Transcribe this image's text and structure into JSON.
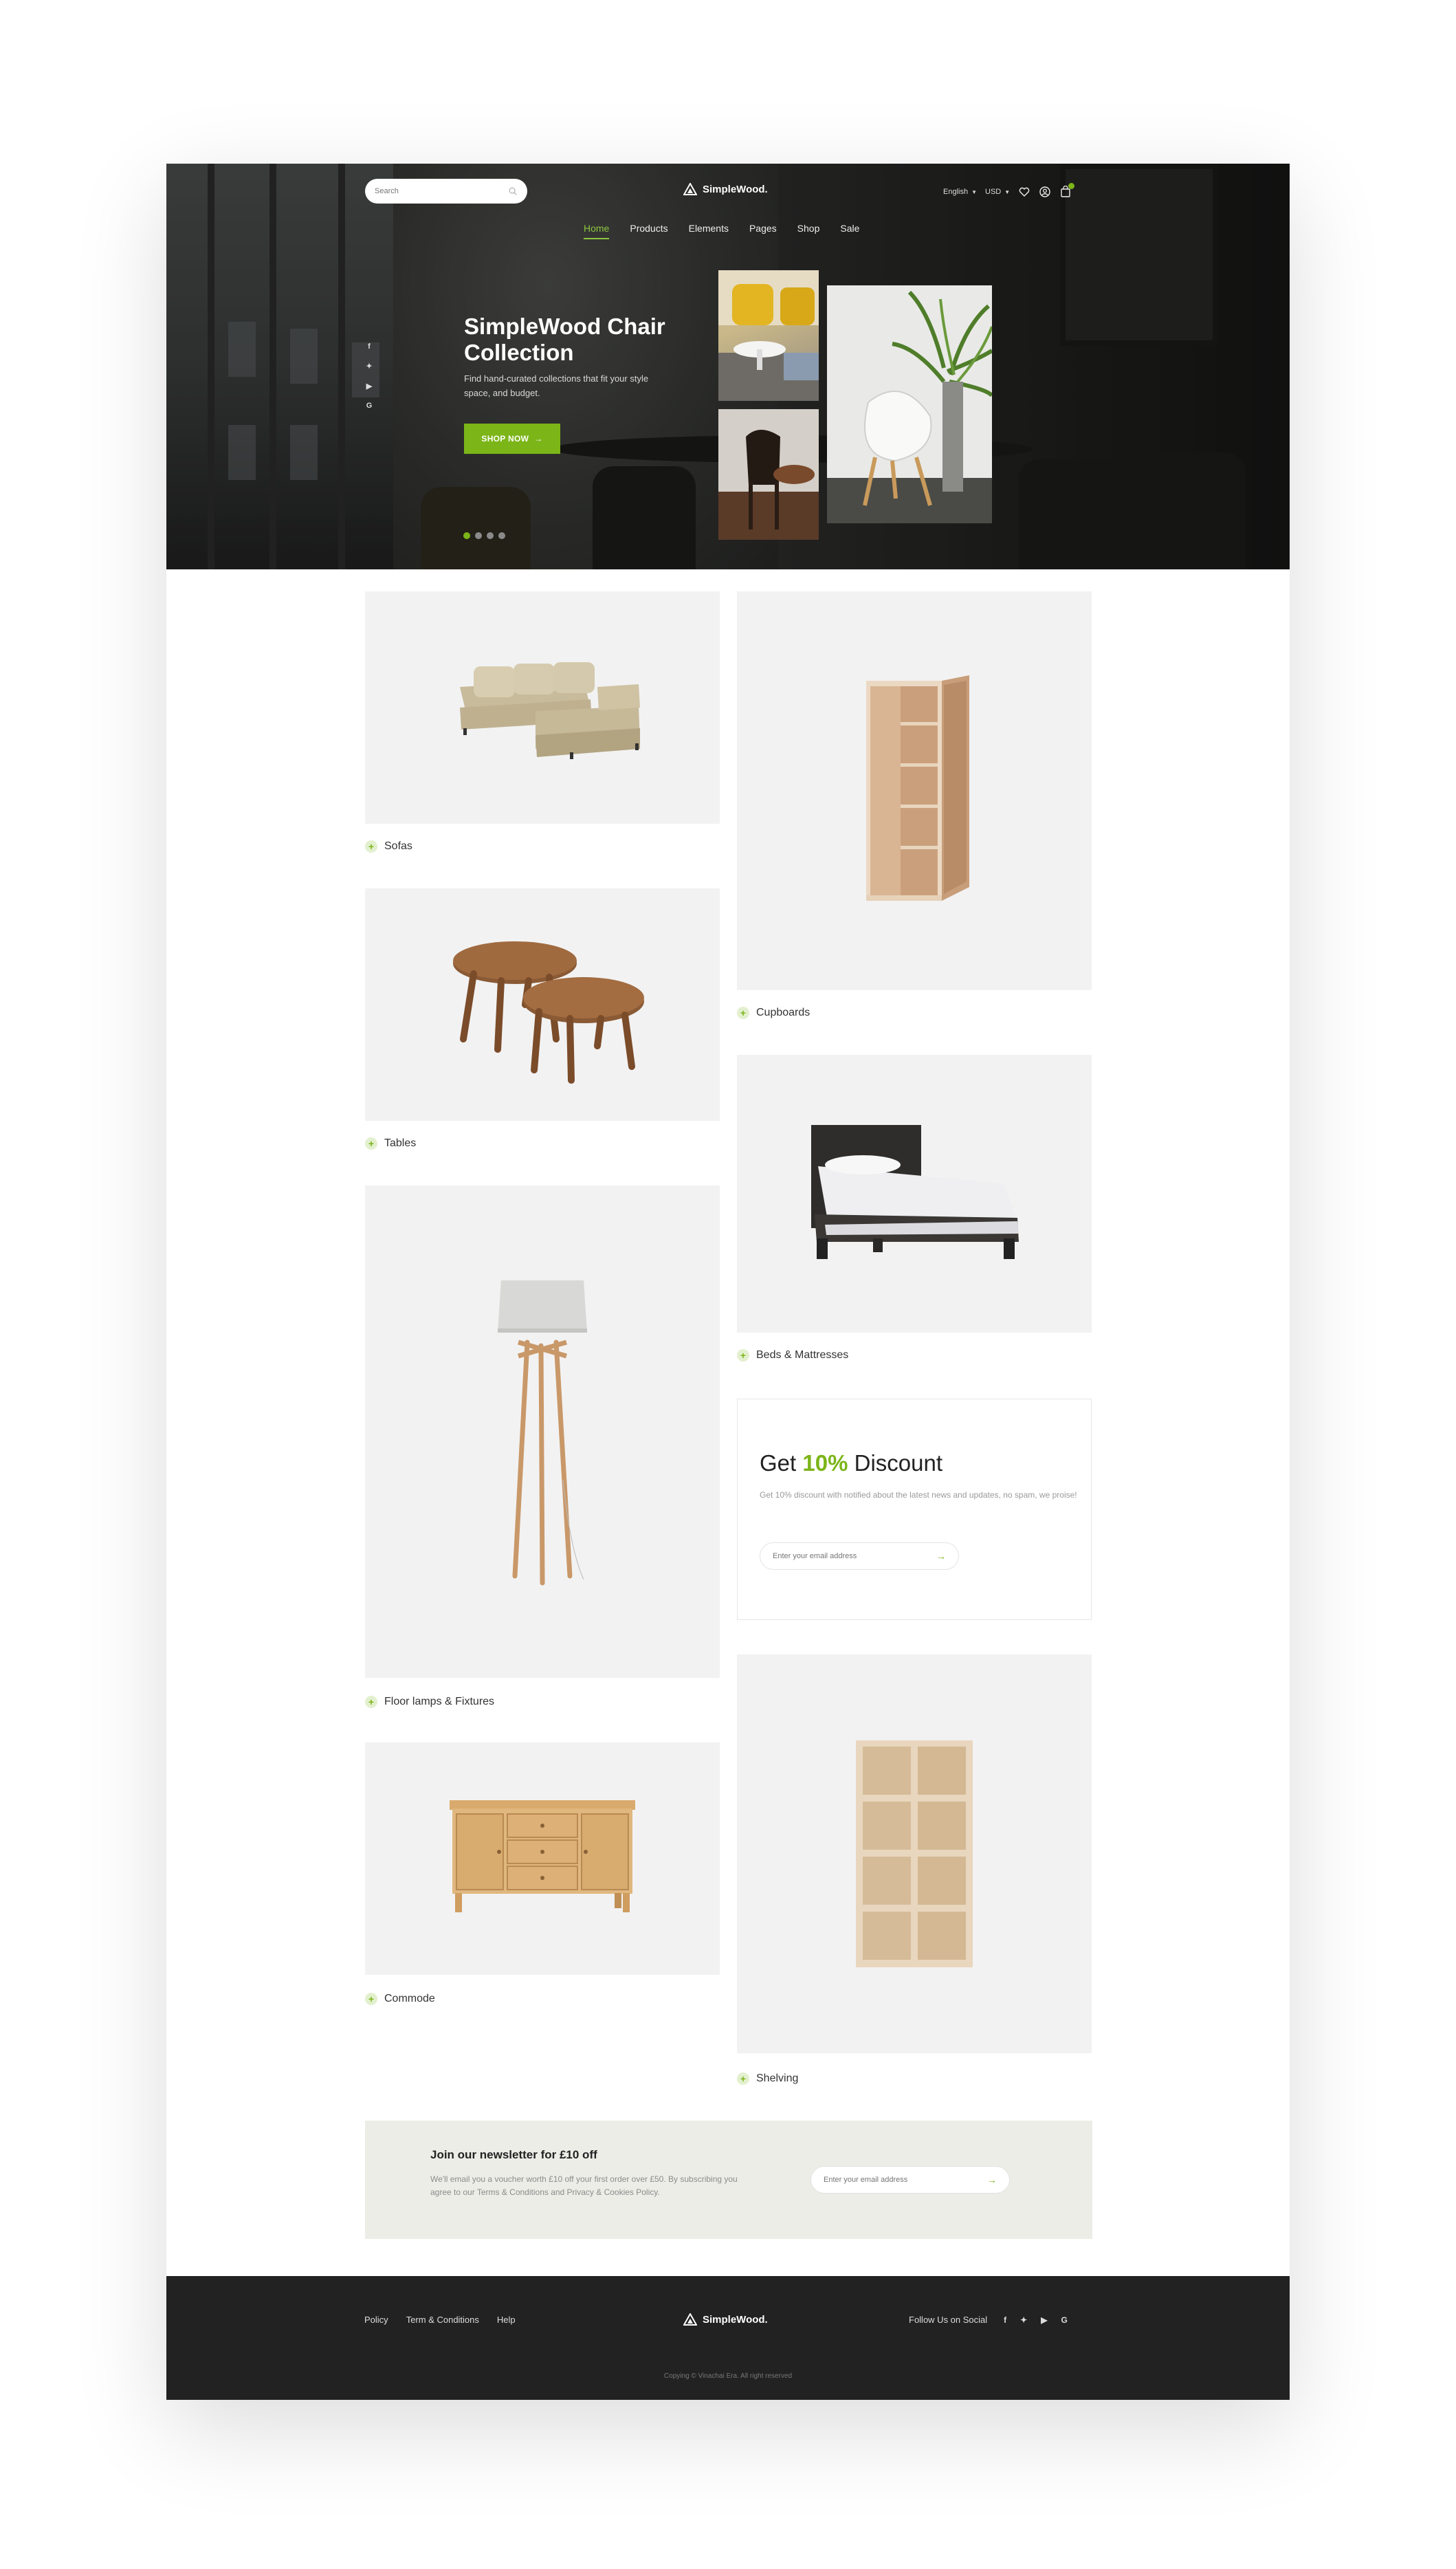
{
  "brand": {
    "name": "SimpleWood.",
    "accent_color": "#7cb518"
  },
  "header": {
    "search_placeholder": "Search",
    "language": "English",
    "currency": "USD",
    "icons": [
      "heart-icon",
      "user-icon",
      "cart-icon"
    ]
  },
  "nav": {
    "items": [
      "Home",
      "Products",
      "Elements",
      "Pages",
      "Shop",
      "Sale"
    ],
    "active": "Home"
  },
  "hero": {
    "title": "SimpleWood Chair Collection",
    "subtitle": "Find hand-curated collections that fit your style space, and budget.",
    "cta": "SHOP NOW",
    "slides": 4,
    "active_slide": 1,
    "socials": [
      "f",
      "t",
      "yt",
      "G"
    ]
  },
  "categories": [
    {
      "label": "Sofas"
    },
    {
      "label": "Cupboards"
    },
    {
      "label": "Tables"
    },
    {
      "label": "Beds & Mattresses"
    },
    {
      "label": "Floor lamps & Fixtures"
    },
    {
      "label": "Commode"
    },
    {
      "label": "Shelving"
    }
  ],
  "discount": {
    "prefix": "Get",
    "highlight": "10%",
    "suffix": "Discount",
    "text": "Get 10% discount with notified about the latest news and updates, no spam, we proise!",
    "placeholder": "Enter your email address"
  },
  "newsletter": {
    "title": "Join our newsletter for £10 off",
    "text": "We'll email you a voucher worth £10 off your first order over £50. By subscribing you agree to our Terms & Conditions and Privacy & Cookies Policy.",
    "placeholder": "Enter your email address"
  },
  "footer": {
    "links": [
      "Policy",
      "Term & Conditions",
      "Help"
    ],
    "follow_label": "Follow Us on Social",
    "social_icons": [
      "f",
      "t",
      "yt",
      "G"
    ],
    "copyright": "Copying © Vinachai Era. All right reserved"
  }
}
